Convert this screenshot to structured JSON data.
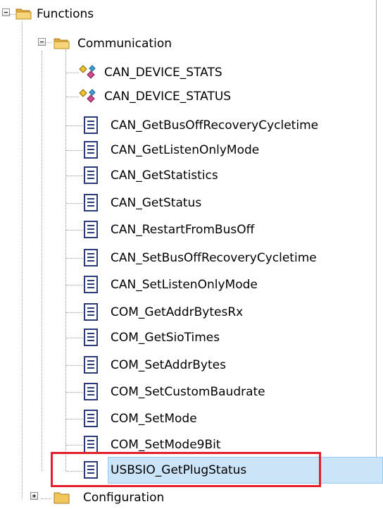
{
  "tree": {
    "root": {
      "label": "Functions",
      "expanded": true,
      "icon": "folder-open-icon"
    },
    "group": {
      "label": "Communication",
      "expanded": true,
      "icon": "folder-open-icon"
    },
    "items": [
      {
        "label": "CAN_DEVICE_STATS",
        "icon": "struct-icon"
      },
      {
        "label": "CAN_DEVICE_STATUS",
        "icon": "struct-icon"
      },
      {
        "label": "CAN_GetBusOffRecoveryCycletime",
        "icon": "document-icon"
      },
      {
        "label": "CAN_GetListenOnlyMode",
        "icon": "document-icon"
      },
      {
        "label": "CAN_GetStatistics",
        "icon": "document-icon"
      },
      {
        "label": "CAN_GetStatus",
        "icon": "document-icon"
      },
      {
        "label": "CAN_RestartFromBusOff",
        "icon": "document-icon"
      },
      {
        "label": "CAN_SetBusOffRecoveryCycletime",
        "icon": "document-icon"
      },
      {
        "label": "CAN_SetListenOnlyMode",
        "icon": "document-icon"
      },
      {
        "label": "COM_GetAddrBytesRx",
        "icon": "document-icon"
      },
      {
        "label": "COM_GetSioTimes",
        "icon": "document-icon"
      },
      {
        "label": "COM_SetAddrBytes",
        "icon": "document-icon"
      },
      {
        "label": "COM_SetCustomBaudrate",
        "icon": "document-icon"
      },
      {
        "label": "COM_SetMode",
        "icon": "document-icon"
      },
      {
        "label": "COM_SetMode9Bit",
        "icon": "document-icon"
      },
      {
        "label": "USBSIO_GetPlugStatus",
        "icon": "document-icon",
        "selected": true
      }
    ],
    "next_group": {
      "label": "Configuration",
      "expanded": false,
      "icon": "folder-icon"
    }
  },
  "colors": {
    "selection_bg": "#cce4f7",
    "selection_border": "#99c9ef",
    "highlight_box": "#e0202a",
    "folder": "#f1c75c"
  }
}
